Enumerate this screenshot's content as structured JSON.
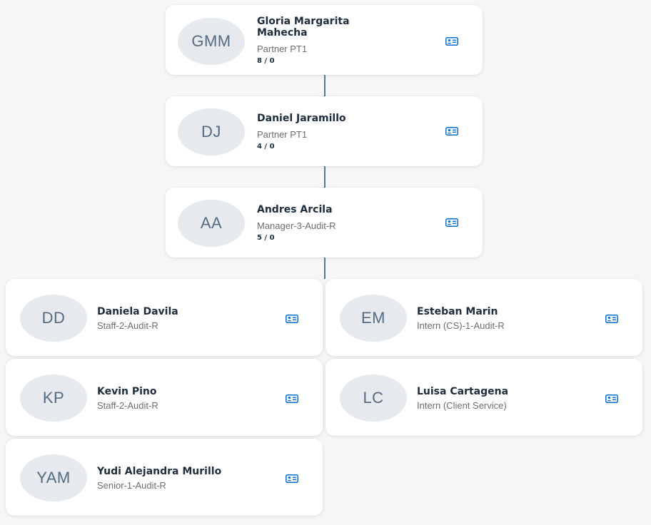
{
  "icons": {
    "avatar": "avatar-circle",
    "details": "contact-card-icon"
  },
  "colors": {
    "background": "#f5f6f7",
    "card": "#ffffff",
    "avatar_bg": "#e6e9ed",
    "avatar_text": "#556b82",
    "connector": "#5b738b",
    "icon": "#0a6ed1"
  },
  "hierarchy": [
    {
      "initials": "GMM",
      "name_line1": "Gloria Margarita",
      "name_line2": "Mahecha",
      "title": "Partner PT1",
      "counts": "8 / 0"
    },
    {
      "initials": "DJ",
      "name_line1": "Daniel Jaramillo",
      "title": "Partner PT1",
      "counts": "4 / 0"
    },
    {
      "initials": "AA",
      "name_line1": "Andres Arcila",
      "title": "Manager-3-Audit-R",
      "counts": "5 / 0"
    }
  ],
  "reports": [
    {
      "initials": "DD",
      "name": "Daniela Davila",
      "title": "Staff-2-Audit-R"
    },
    {
      "initials": "EM",
      "name": "Esteban Marin",
      "title": "Intern (CS)-1-Audit-R"
    },
    {
      "initials": "KP",
      "name": "Kevin Pino",
      "title": "Staff-2-Audit-R"
    },
    {
      "initials": "LC",
      "name": "Luisa Cartagena",
      "title": "Intern (Client Service)"
    },
    {
      "initials": "YAM",
      "name": "Yudi Alejandra Murillo",
      "title": "Senior-1-Audit-R"
    }
  ]
}
